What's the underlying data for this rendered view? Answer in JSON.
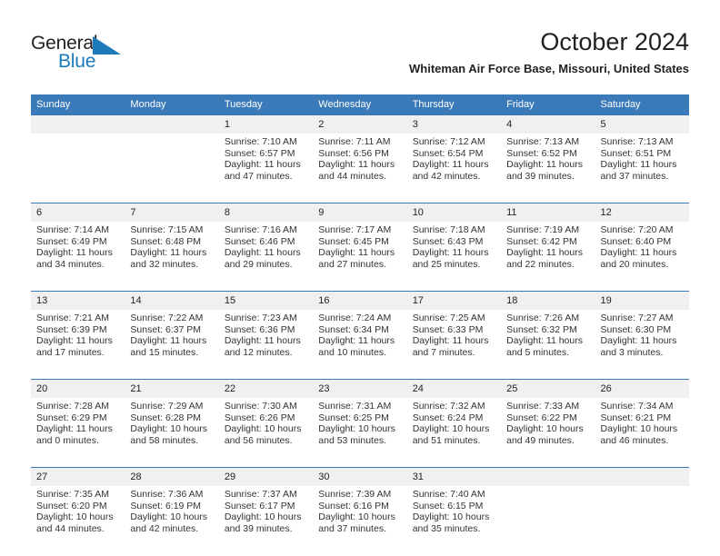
{
  "brand": {
    "name_part1": "General",
    "name_part2": "Blue",
    "accent_color": "#1d7ab8"
  },
  "header": {
    "title": "October 2024",
    "subtitle": "Whiteman Air Force Base, Missouri, United States",
    "header_bg_color": "#3a7ab8",
    "date_strip_color": "#f0f0f0"
  },
  "weekday_headers": [
    "Sunday",
    "Monday",
    "Tuesday",
    "Wednesday",
    "Thursday",
    "Friday",
    "Saturday"
  ],
  "weeks": [
    {
      "dates": [
        "",
        "",
        "1",
        "2",
        "3",
        "4",
        "5"
      ],
      "cells": [
        {
          "empty": true
        },
        {
          "empty": true
        },
        {
          "sunrise": "Sunrise: 7:10 AM",
          "sunset": "Sunset: 6:57 PM",
          "daylight1": "Daylight: 11 hours",
          "daylight2": "and 47 minutes."
        },
        {
          "sunrise": "Sunrise: 7:11 AM",
          "sunset": "Sunset: 6:56 PM",
          "daylight1": "Daylight: 11 hours",
          "daylight2": "and 44 minutes."
        },
        {
          "sunrise": "Sunrise: 7:12 AM",
          "sunset": "Sunset: 6:54 PM",
          "daylight1": "Daylight: 11 hours",
          "daylight2": "and 42 minutes."
        },
        {
          "sunrise": "Sunrise: 7:13 AM",
          "sunset": "Sunset: 6:52 PM",
          "daylight1": "Daylight: 11 hours",
          "daylight2": "and 39 minutes."
        },
        {
          "sunrise": "Sunrise: 7:13 AM",
          "sunset": "Sunset: 6:51 PM",
          "daylight1": "Daylight: 11 hours",
          "daylight2": "and 37 minutes."
        }
      ]
    },
    {
      "dates": [
        "6",
        "7",
        "8",
        "9",
        "10",
        "11",
        "12"
      ],
      "cells": [
        {
          "sunrise": "Sunrise: 7:14 AM",
          "sunset": "Sunset: 6:49 PM",
          "daylight1": "Daylight: 11 hours",
          "daylight2": "and 34 minutes."
        },
        {
          "sunrise": "Sunrise: 7:15 AM",
          "sunset": "Sunset: 6:48 PM",
          "daylight1": "Daylight: 11 hours",
          "daylight2": "and 32 minutes."
        },
        {
          "sunrise": "Sunrise: 7:16 AM",
          "sunset": "Sunset: 6:46 PM",
          "daylight1": "Daylight: 11 hours",
          "daylight2": "and 29 minutes."
        },
        {
          "sunrise": "Sunrise: 7:17 AM",
          "sunset": "Sunset: 6:45 PM",
          "daylight1": "Daylight: 11 hours",
          "daylight2": "and 27 minutes."
        },
        {
          "sunrise": "Sunrise: 7:18 AM",
          "sunset": "Sunset: 6:43 PM",
          "daylight1": "Daylight: 11 hours",
          "daylight2": "and 25 minutes."
        },
        {
          "sunrise": "Sunrise: 7:19 AM",
          "sunset": "Sunset: 6:42 PM",
          "daylight1": "Daylight: 11 hours",
          "daylight2": "and 22 minutes."
        },
        {
          "sunrise": "Sunrise: 7:20 AM",
          "sunset": "Sunset: 6:40 PM",
          "daylight1": "Daylight: 11 hours",
          "daylight2": "and 20 minutes."
        }
      ]
    },
    {
      "dates": [
        "13",
        "14",
        "15",
        "16",
        "17",
        "18",
        "19"
      ],
      "cells": [
        {
          "sunrise": "Sunrise: 7:21 AM",
          "sunset": "Sunset: 6:39 PM",
          "daylight1": "Daylight: 11 hours",
          "daylight2": "and 17 minutes."
        },
        {
          "sunrise": "Sunrise: 7:22 AM",
          "sunset": "Sunset: 6:37 PM",
          "daylight1": "Daylight: 11 hours",
          "daylight2": "and 15 minutes."
        },
        {
          "sunrise": "Sunrise: 7:23 AM",
          "sunset": "Sunset: 6:36 PM",
          "daylight1": "Daylight: 11 hours",
          "daylight2": "and 12 minutes."
        },
        {
          "sunrise": "Sunrise: 7:24 AM",
          "sunset": "Sunset: 6:34 PM",
          "daylight1": "Daylight: 11 hours",
          "daylight2": "and 10 minutes."
        },
        {
          "sunrise": "Sunrise: 7:25 AM",
          "sunset": "Sunset: 6:33 PM",
          "daylight1": "Daylight: 11 hours",
          "daylight2": "and 7 minutes."
        },
        {
          "sunrise": "Sunrise: 7:26 AM",
          "sunset": "Sunset: 6:32 PM",
          "daylight1": "Daylight: 11 hours",
          "daylight2": "and 5 minutes."
        },
        {
          "sunrise": "Sunrise: 7:27 AM",
          "sunset": "Sunset: 6:30 PM",
          "daylight1": "Daylight: 11 hours",
          "daylight2": "and 3 minutes."
        }
      ]
    },
    {
      "dates": [
        "20",
        "21",
        "22",
        "23",
        "24",
        "25",
        "26"
      ],
      "cells": [
        {
          "sunrise": "Sunrise: 7:28 AM",
          "sunset": "Sunset: 6:29 PM",
          "daylight1": "Daylight: 11 hours",
          "daylight2": "and 0 minutes."
        },
        {
          "sunrise": "Sunrise: 7:29 AM",
          "sunset": "Sunset: 6:28 PM",
          "daylight1": "Daylight: 10 hours",
          "daylight2": "and 58 minutes."
        },
        {
          "sunrise": "Sunrise: 7:30 AM",
          "sunset": "Sunset: 6:26 PM",
          "daylight1": "Daylight: 10 hours",
          "daylight2": "and 56 minutes."
        },
        {
          "sunrise": "Sunrise: 7:31 AM",
          "sunset": "Sunset: 6:25 PM",
          "daylight1": "Daylight: 10 hours",
          "daylight2": "and 53 minutes."
        },
        {
          "sunrise": "Sunrise: 7:32 AM",
          "sunset": "Sunset: 6:24 PM",
          "daylight1": "Daylight: 10 hours",
          "daylight2": "and 51 minutes."
        },
        {
          "sunrise": "Sunrise: 7:33 AM",
          "sunset": "Sunset: 6:22 PM",
          "daylight1": "Daylight: 10 hours",
          "daylight2": "and 49 minutes."
        },
        {
          "sunrise": "Sunrise: 7:34 AM",
          "sunset": "Sunset: 6:21 PM",
          "daylight1": "Daylight: 10 hours",
          "daylight2": "and 46 minutes."
        }
      ]
    },
    {
      "dates": [
        "27",
        "28",
        "29",
        "30",
        "31",
        "",
        ""
      ],
      "cells": [
        {
          "sunrise": "Sunrise: 7:35 AM",
          "sunset": "Sunset: 6:20 PM",
          "daylight1": "Daylight: 10 hours",
          "daylight2": "and 44 minutes."
        },
        {
          "sunrise": "Sunrise: 7:36 AM",
          "sunset": "Sunset: 6:19 PM",
          "daylight1": "Daylight: 10 hours",
          "daylight2": "and 42 minutes."
        },
        {
          "sunrise": "Sunrise: 7:37 AM",
          "sunset": "Sunset: 6:17 PM",
          "daylight1": "Daylight: 10 hours",
          "daylight2": "and 39 minutes."
        },
        {
          "sunrise": "Sunrise: 7:39 AM",
          "sunset": "Sunset: 6:16 PM",
          "daylight1": "Daylight: 10 hours",
          "daylight2": "and 37 minutes."
        },
        {
          "sunrise": "Sunrise: 7:40 AM",
          "sunset": "Sunset: 6:15 PM",
          "daylight1": "Daylight: 10 hours",
          "daylight2": "and 35 minutes."
        },
        {
          "empty": true
        },
        {
          "empty": true
        }
      ]
    }
  ]
}
